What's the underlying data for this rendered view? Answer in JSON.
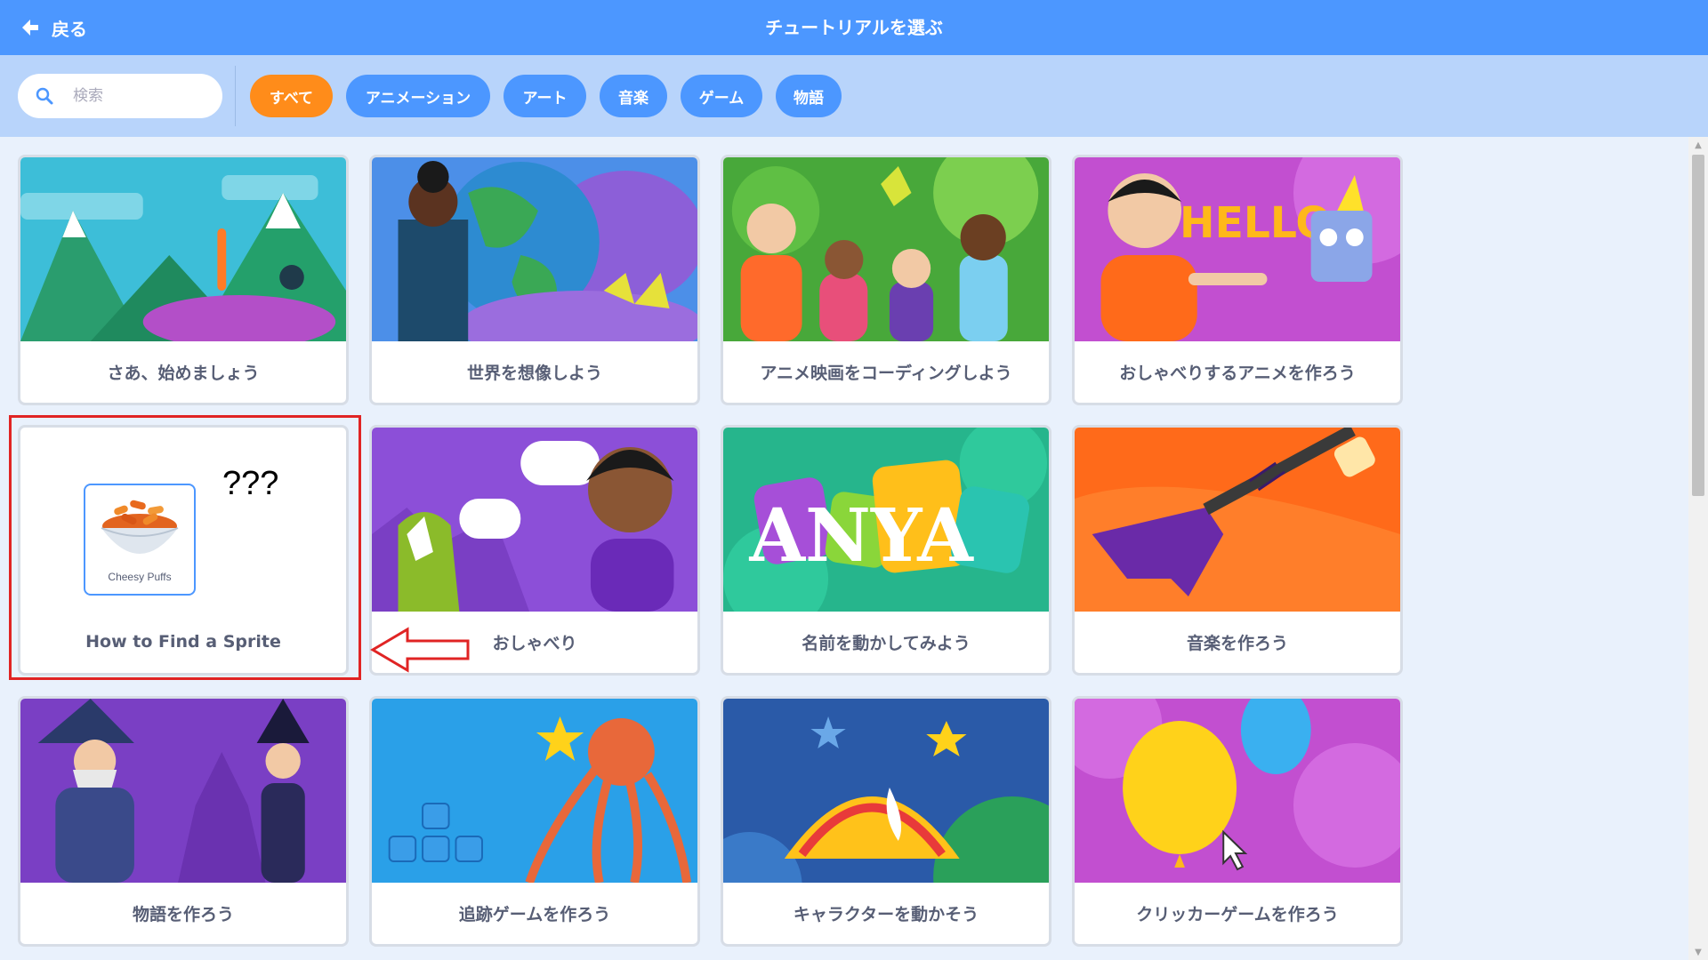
{
  "header": {
    "back_label": "戻る",
    "title": "チュートリアルを選ぶ"
  },
  "search": {
    "placeholder": "検索"
  },
  "filters": [
    {
      "label": "すべて",
      "active": true
    },
    {
      "label": "アニメーション",
      "active": false
    },
    {
      "label": "アート",
      "active": false
    },
    {
      "label": "音楽",
      "active": false
    },
    {
      "label": "ゲーム",
      "active": false
    },
    {
      "label": "物語",
      "active": false
    }
  ],
  "cards": [
    {
      "label": "さあ、始めましょう"
    },
    {
      "label": "世界を想像しよう"
    },
    {
      "label": "アニメ映画をコーディングしよう"
    },
    {
      "label": "おしゃべりするアニメを作ろう"
    },
    {
      "label": "How to Find a Sprite",
      "sprite_name": "Cheesy Puffs",
      "note": "???"
    },
    {
      "label": "おしゃべり"
    },
    {
      "label": "名前を動かしてみよう",
      "thumb_text": "ANYA"
    },
    {
      "label": "音楽を作ろう"
    },
    {
      "label": "物語を作ろう"
    },
    {
      "label": "追跡ゲームを作ろう"
    },
    {
      "label": "キャラクターを動かそう"
    },
    {
      "label": "クリッカーゲームを作ろう"
    }
  ],
  "colors": {
    "header": "#4c97ff",
    "filterbar": "#b8d4fb",
    "active_chip": "#ff8c1a",
    "chip": "#4c97ff",
    "highlight": "#e02424"
  }
}
